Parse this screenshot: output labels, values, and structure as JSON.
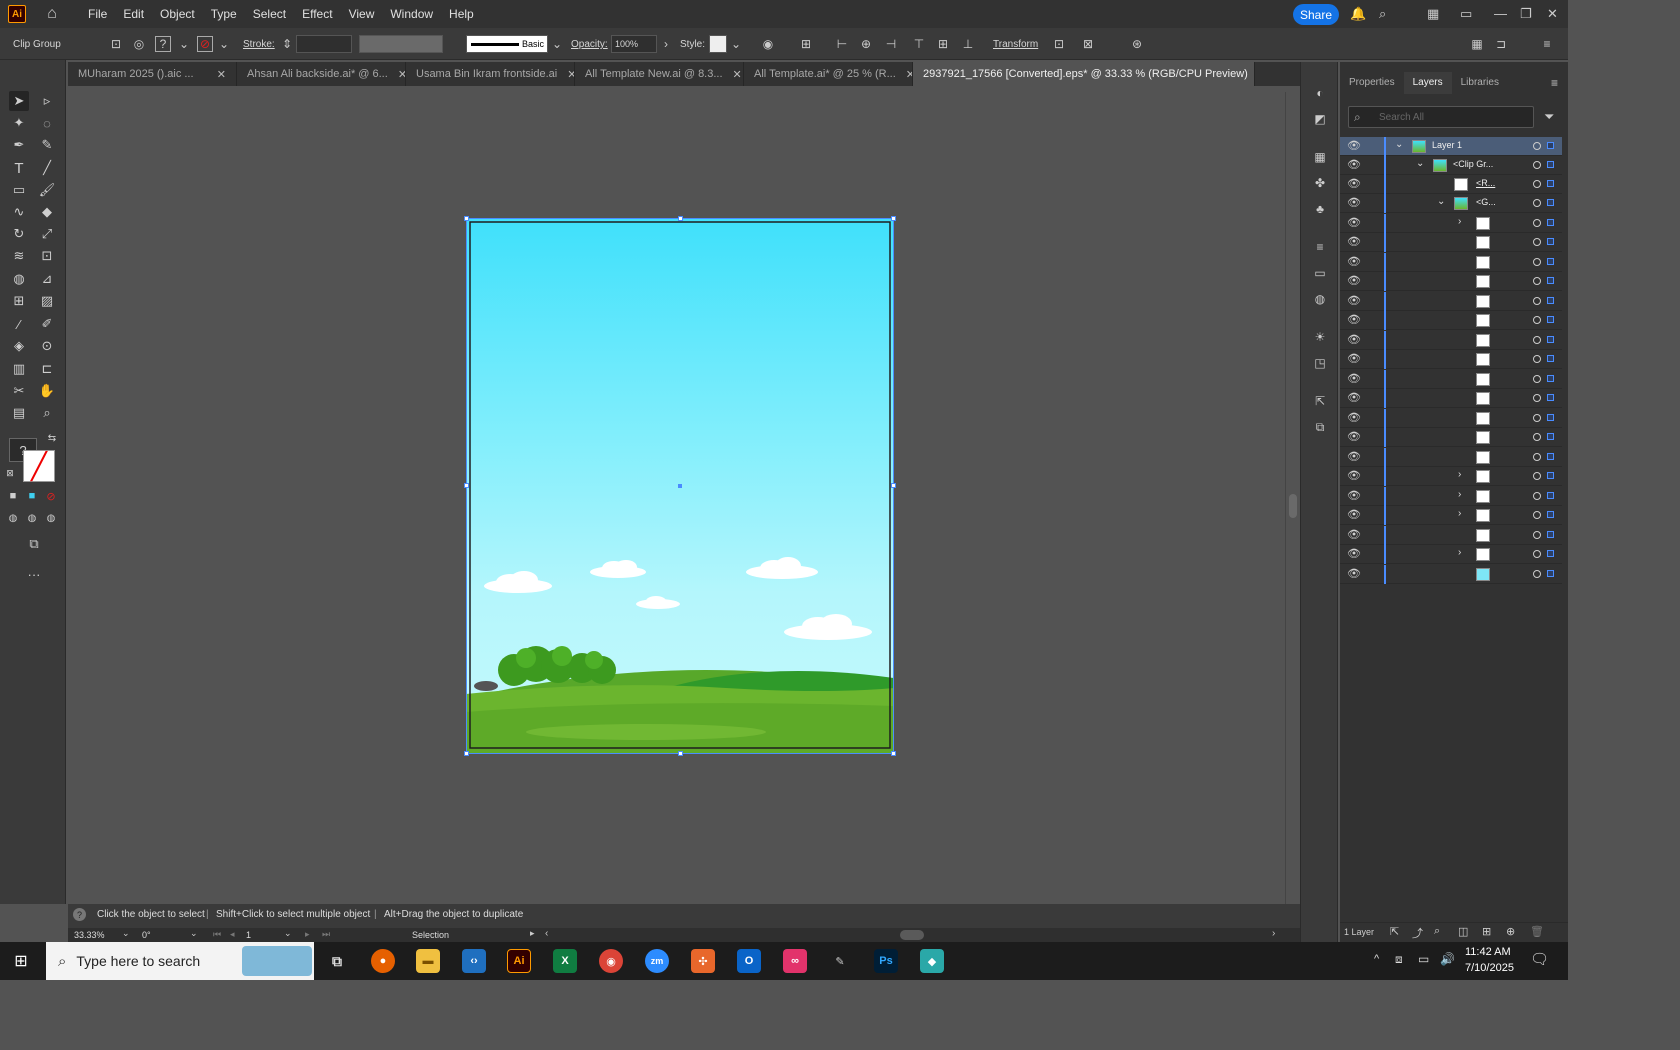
{
  "app": {
    "logo": "Ai",
    "menus": [
      "File",
      "Edit",
      "Object",
      "Type",
      "Select",
      "Effect",
      "View",
      "Window",
      "Help"
    ],
    "share_label": "Share"
  },
  "control_bar": {
    "selection_type": "Clip Group",
    "stroke_label": "Stroke:",
    "stroke_value": "",
    "brush_label": "Basic",
    "opacity_label": "Opacity:",
    "opacity_value": "100%",
    "style_label": "Style:",
    "transform_label": "Transform"
  },
  "tabs": [
    {
      "label": "MUharam 2025 ().aic ...",
      "active": false
    },
    {
      "label": "Ahsan Ali backside.ai* @ 6...",
      "active": false
    },
    {
      "label": "Usama Bin Ikram frontside.ai",
      "active": false
    },
    {
      "label": "All Template New.ai @ 8.3...",
      "active": false
    },
    {
      "label": "All Template.ai* @ 25 % (R...",
      "active": false
    },
    {
      "label": "2937921_17566 [Converted].eps* @ 33.33 % (RGB/CPU Preview)",
      "active": true
    }
  ],
  "panel": {
    "tabs": [
      "Properties",
      "Layers",
      "Libraries"
    ],
    "active_tab": "Layers",
    "search_placeholder": "Search All",
    "layers": [
      {
        "name": "Layer 1",
        "level": 0,
        "expanded": true
      },
      {
        "name": "<Clip Gr...",
        "level": 1,
        "expanded": true
      },
      {
        "name": "<R...",
        "level": 2
      },
      {
        "name": "<G...",
        "level": 2,
        "expanded": true
      }
    ],
    "footer_count": "1 Layer"
  },
  "status": {
    "hint_select": "Click the object to select",
    "hint_multi": "Shift+Click to select multiple object",
    "hint_dup": "Alt+Drag the object to duplicate",
    "zoom": "33.33%",
    "rotation": "0°",
    "artboard_num": "1",
    "tool_name": "Selection"
  },
  "taskbar": {
    "search_placeholder": "Type here to search",
    "time": "11:42 AM",
    "date": "7/10/2025"
  },
  "colors": {
    "accent": "#1473e6",
    "selection": "#4a8cff",
    "sky_top": "#3fe0fb",
    "grass": "#6bb52e"
  }
}
